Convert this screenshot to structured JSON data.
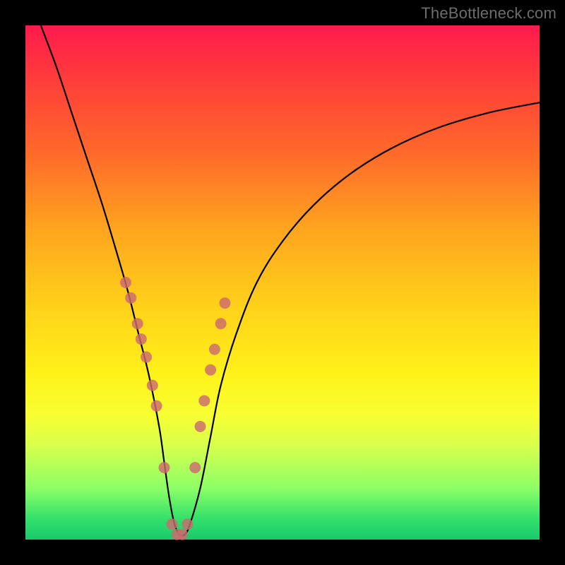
{
  "watermark": "TheBottleneck.com",
  "chart_data": {
    "type": "line",
    "title": "",
    "xlabel": "",
    "ylabel": "",
    "xlim": [
      0,
      100
    ],
    "ylim": [
      0,
      100
    ],
    "note": "Unlabeled bottleneck-style curve chart with rainbow vertical gradient background. Axes carry no tick labels. Y appears to represent bottleneck percentage (0 at bottom, ~100 at top). X likely represents component balance ratio. Values are estimated from pixel positions.",
    "series": [
      {
        "name": "bottleneck-curve",
        "x": [
          3,
          6,
          9,
          12,
          15,
          18,
          20,
          22,
          24,
          26,
          27,
          28,
          29,
          30,
          31,
          32,
          34,
          36,
          38,
          41,
          45,
          50,
          56,
          63,
          71,
          80,
          90,
          100
        ],
        "y": [
          100,
          92,
          83,
          74,
          65,
          55,
          48,
          40,
          32,
          22,
          15,
          8,
          3,
          1,
          1,
          3,
          10,
          20,
          30,
          40,
          50,
          58,
          65,
          71,
          76,
          80,
          83,
          85
        ]
      }
    ],
    "markers": {
      "name": "highlighted-region-points",
      "color": "#cc6a6f",
      "radius_px": 8,
      "x": [
        19.5,
        20.5,
        21.8,
        22.5,
        23.5,
        24.7,
        25.5,
        27.0,
        28.5,
        29.5,
        30.5,
        31.5,
        33.0,
        34.0,
        34.8,
        36.0,
        36.8,
        38.0,
        38.8
      ],
      "y": [
        50.0,
        47.0,
        42.0,
        39.0,
        35.5,
        30.0,
        26.0,
        14.0,
        3.0,
        1.0,
        1.0,
        3.0,
        14.0,
        22.0,
        27.0,
        33.0,
        37.0,
        42.0,
        46.0
      ]
    },
    "gradient_stops": [
      {
        "pos": 0.0,
        "color": "#ff1a4d"
      },
      {
        "pos": 0.1,
        "color": "#ff3b3b"
      },
      {
        "pos": 0.25,
        "color": "#ff6a2a"
      },
      {
        "pos": 0.4,
        "color": "#ffa61f"
      },
      {
        "pos": 0.55,
        "color": "#ffd21a"
      },
      {
        "pos": 0.68,
        "color": "#fff21a"
      },
      {
        "pos": 0.76,
        "color": "#f7ff33"
      },
      {
        "pos": 0.82,
        "color": "#d6ff4d"
      },
      {
        "pos": 0.9,
        "color": "#8cff66"
      },
      {
        "pos": 0.96,
        "color": "#33e06b"
      },
      {
        "pos": 1.0,
        "color": "#19c96b"
      }
    ]
  }
}
